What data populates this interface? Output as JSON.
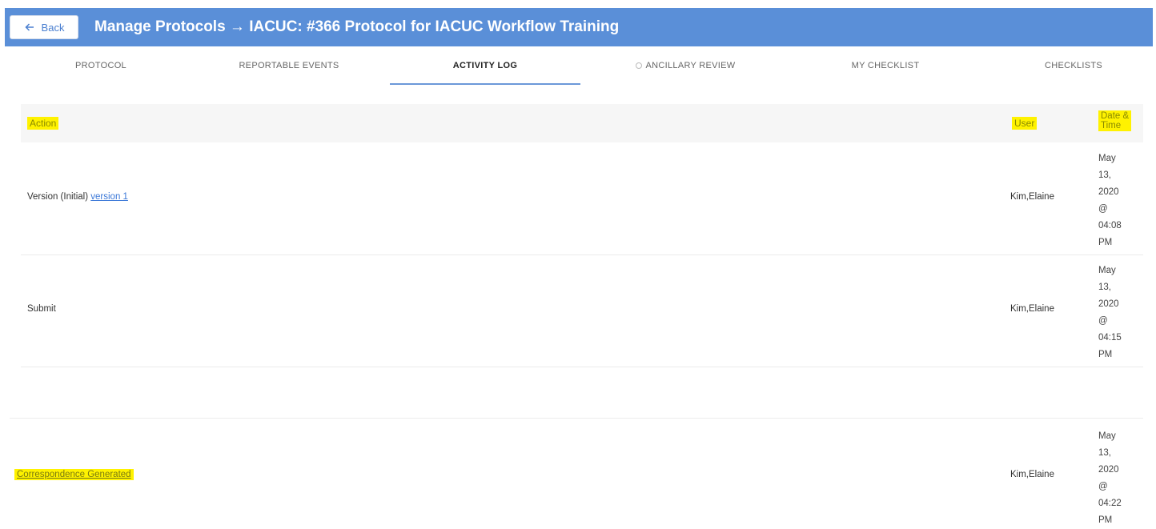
{
  "header": {
    "back_label": "Back",
    "title": "Manage Protocols → IACUC: #366 Protocol for IACUC Workflow Training",
    "background_color": "#5a8fd8"
  },
  "tabs": [
    {
      "label": "PROTOCOL"
    },
    {
      "label": "REPORTABLE EVENTS"
    },
    {
      "label": "ACTIVITY LOG",
      "active": true
    },
    {
      "label": "ANCILLARY REVIEW"
    },
    {
      "label": "MY CHECKLIST"
    },
    {
      "label": "CHECKLISTS"
    }
  ],
  "table": {
    "headers": {
      "action": "Action",
      "user": "User",
      "date_time_line1": "Date &",
      "date_time_line2": "Time"
    },
    "rows": [
      {
        "action_text": "Version (Initial)",
        "action_link": "version 1",
        "user": "Kim,Elaine",
        "date": [
          "May",
          "13,",
          "2020",
          "@",
          "04:08",
          "PM"
        ]
      },
      {
        "action_text": "Submit",
        "user": "Kim,Elaine",
        "date": [
          "May",
          "13,",
          "2020",
          "@",
          "04:15",
          "PM"
        ]
      },
      {
        "action_link": "Correspondence Generated",
        "user": "Kim,Elaine",
        "date": [
          "May",
          "13,",
          "2020",
          "@",
          "04:22",
          "PM"
        ]
      }
    ]
  }
}
